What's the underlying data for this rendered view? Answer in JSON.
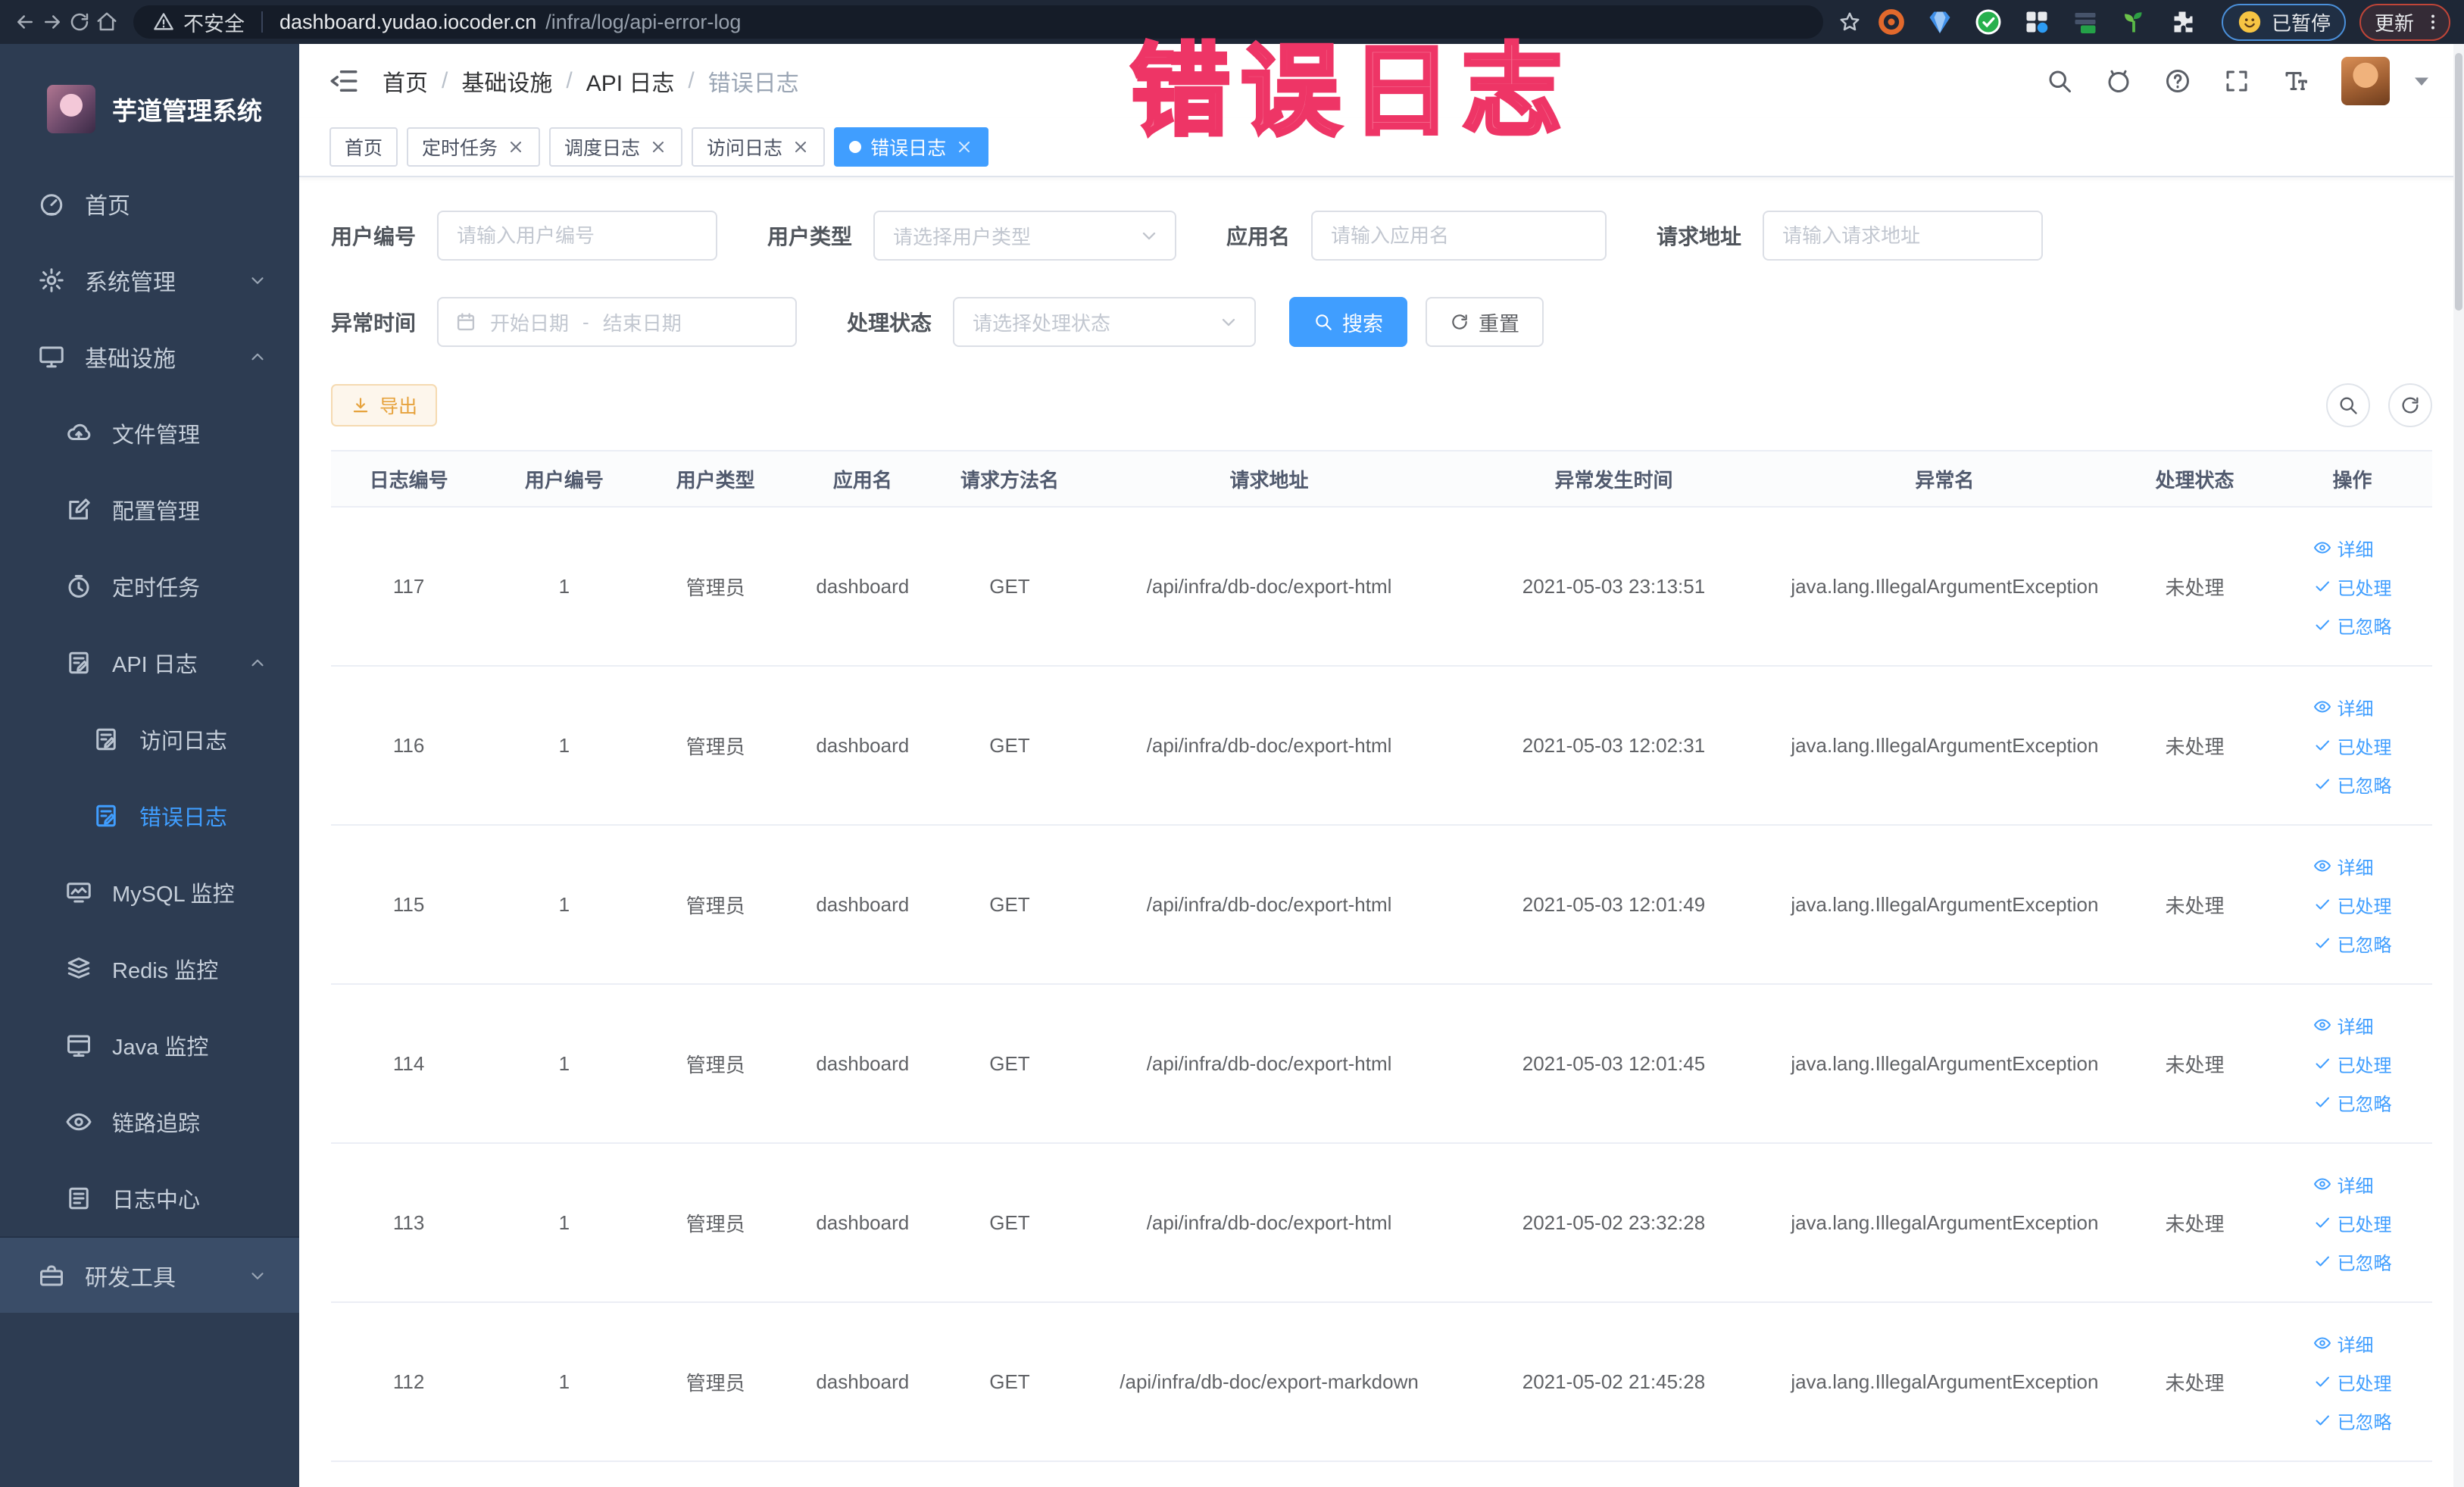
{
  "browser": {
    "security_label": "不安全",
    "url_host": "dashboard.yudao.iocoder.cn",
    "url_path": "/infra/log/api-error-log",
    "profile_status": "已暂停",
    "update_label": "更新",
    "extension_icons": [
      "adguard-icon",
      "proxy-shield-icon",
      "verified-green-icon",
      "tab-grid-icon",
      "switch-on-icon",
      "sprout-icon",
      "extensions-puzzle-icon"
    ]
  },
  "watermark": "错误日志",
  "sidebar": {
    "app_title": "芋道管理系统",
    "items": [
      {
        "label": "首页",
        "icon": "dashboard-icon",
        "level": 1
      },
      {
        "label": "系统管理",
        "icon": "gear-icon",
        "level": 1,
        "arrow": "down"
      },
      {
        "label": "基础设施",
        "icon": "monitor-icon",
        "level": 1,
        "arrow": "up"
      },
      {
        "label": "文件管理",
        "icon": "cloud-upload-icon",
        "level": 2
      },
      {
        "label": "配置管理",
        "icon": "edit-square-icon",
        "level": 2
      },
      {
        "label": "定时任务",
        "icon": "timer-icon",
        "level": 2
      },
      {
        "label": "API 日志",
        "icon": "log-doc-icon",
        "level": 2,
        "arrow": "up"
      },
      {
        "label": "访问日志",
        "icon": "log-doc-icon",
        "level": 3
      },
      {
        "label": "错误日志",
        "icon": "log-doc-icon",
        "level": 3,
        "active": true
      },
      {
        "label": "MySQL 监控",
        "icon": "mysql-monitor-icon",
        "level": 2
      },
      {
        "label": "Redis 监控",
        "icon": "redis-icon",
        "level": 2
      },
      {
        "label": "Java 监控",
        "icon": "java-monitor-icon",
        "level": 2
      },
      {
        "label": "链路追踪",
        "icon": "trace-eye-icon",
        "level": 2
      },
      {
        "label": "日志中心",
        "icon": "log-center-icon",
        "level": 2
      },
      {
        "label": "研发工具",
        "icon": "toolbox-icon",
        "level": 1,
        "arrow": "down",
        "variant": "section"
      }
    ]
  },
  "navbar": {
    "breadcrumb": [
      "首页",
      "基础设施",
      "API 日志",
      "错误日志"
    ]
  },
  "tabs": [
    {
      "label": "首页",
      "closable": false,
      "active": false
    },
    {
      "label": "定时任务",
      "closable": true,
      "active": false
    },
    {
      "label": "调度日志",
      "closable": true,
      "active": false
    },
    {
      "label": "访问日志",
      "closable": true,
      "active": false
    },
    {
      "label": "错误日志",
      "closable": true,
      "active": true
    }
  ],
  "filters": {
    "user_id": {
      "label": "用户编号",
      "placeholder": "请输入用户编号"
    },
    "user_type": {
      "label": "用户类型",
      "placeholder": "请选择用户类型"
    },
    "app_name": {
      "label": "应用名",
      "placeholder": "请输入应用名"
    },
    "request_url": {
      "label": "请求地址",
      "placeholder": "请输入请求地址"
    },
    "exception_time": {
      "label": "异常时间",
      "start_placeholder": "开始日期",
      "separator": "-",
      "end_placeholder": "结束日期"
    },
    "process_status": {
      "label": "处理状态",
      "placeholder": "请选择处理状态"
    },
    "search_label": "搜索",
    "reset_label": "重置"
  },
  "toolbar": {
    "export_label": "导出"
  },
  "table": {
    "headers": [
      "日志编号",
      "用户编号",
      "用户类型",
      "应用名",
      "请求方法名",
      "请求地址",
      "异常发生时间",
      "异常名",
      "处理状态",
      "操作"
    ],
    "actions": [
      {
        "label": "详细",
        "icon": "eye-icon"
      },
      {
        "label": "已处理",
        "icon": "check-icon"
      },
      {
        "label": "已忽略",
        "icon": "check-icon"
      }
    ],
    "rows": [
      {
        "log_id": "117",
        "user_id": "1",
        "user_type": "管理员",
        "app_name": "dashboard",
        "method": "GET",
        "request_url": "/api/infra/db-doc/export-html",
        "time": "2021-05-03 23:13:51",
        "exception": "java.lang.IllegalArgumentException",
        "status": "未处理"
      },
      {
        "log_id": "116",
        "user_id": "1",
        "user_type": "管理员",
        "app_name": "dashboard",
        "method": "GET",
        "request_url": "/api/infra/db-doc/export-html",
        "time": "2021-05-03 12:02:31",
        "exception": "java.lang.IllegalArgumentException",
        "status": "未处理"
      },
      {
        "log_id": "115",
        "user_id": "1",
        "user_type": "管理员",
        "app_name": "dashboard",
        "method": "GET",
        "request_url": "/api/infra/db-doc/export-html",
        "time": "2021-05-03 12:01:49",
        "exception": "java.lang.IllegalArgumentException",
        "status": "未处理"
      },
      {
        "log_id": "114",
        "user_id": "1",
        "user_type": "管理员",
        "app_name": "dashboard",
        "method": "GET",
        "request_url": "/api/infra/db-doc/export-html",
        "time": "2021-05-03 12:01:45",
        "exception": "java.lang.IllegalArgumentException",
        "status": "未处理"
      },
      {
        "log_id": "113",
        "user_id": "1",
        "user_type": "管理员",
        "app_name": "dashboard",
        "method": "GET",
        "request_url": "/api/infra/db-doc/export-html",
        "time": "2021-05-02 23:32:28",
        "exception": "java.lang.IllegalArgumentException",
        "status": "未处理"
      },
      {
        "log_id": "112",
        "user_id": "1",
        "user_type": "管理员",
        "app_name": "dashboard",
        "method": "GET",
        "request_url": "/api/infra/db-doc/export-markdown",
        "time": "2021-05-02 21:45:28",
        "exception": "java.lang.IllegalArgumentException",
        "status": "未处理"
      }
    ]
  },
  "colors": {
    "accent": "#409eff",
    "warning": "#e6a23c",
    "watermark_pink": "#ee3566",
    "sidebar_bg": "#2d3c52",
    "chrome_bg": "#1e2736"
  }
}
